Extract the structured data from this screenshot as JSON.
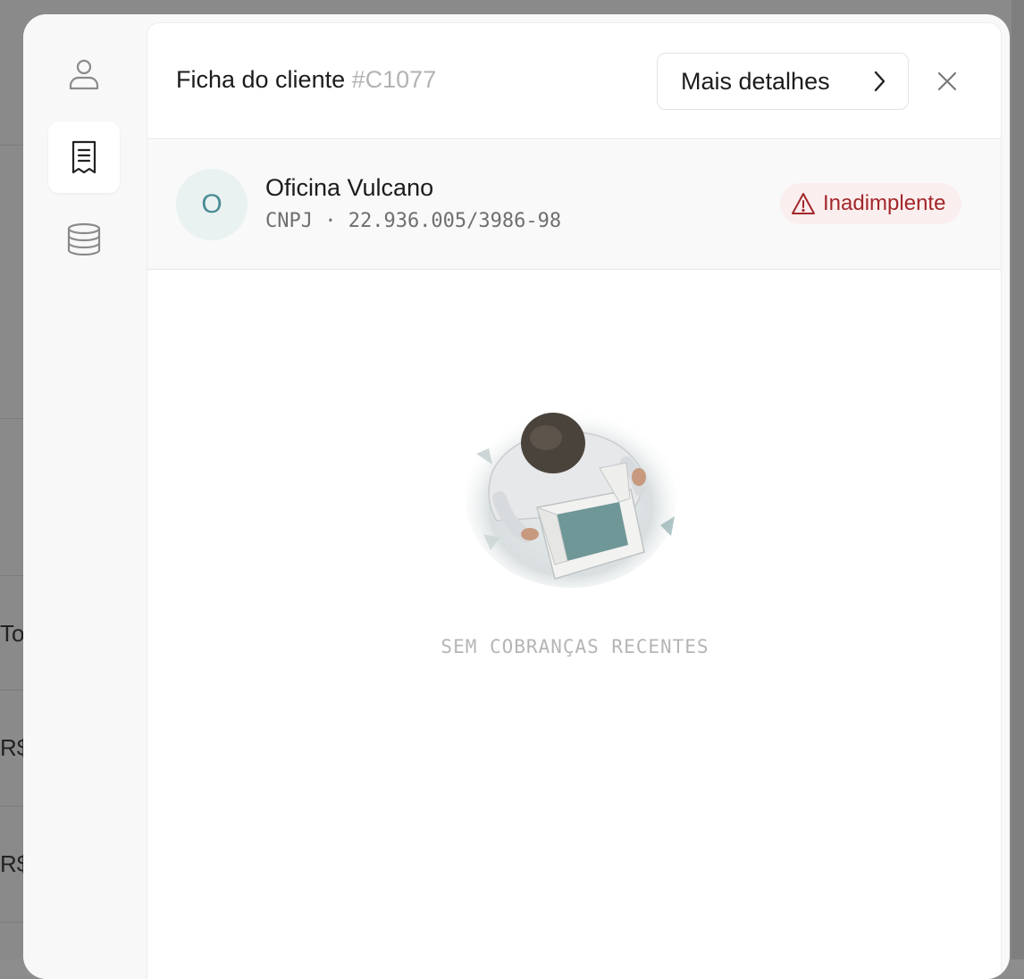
{
  "background": {
    "rows": [
      "To",
      "R$",
      "R$"
    ]
  },
  "rail": {
    "items": [
      {
        "icon": "user-icon",
        "active": false
      },
      {
        "icon": "receipt-icon",
        "active": true
      },
      {
        "icon": "database-icon",
        "active": false
      }
    ]
  },
  "header": {
    "title": "Ficha do cliente",
    "code": "#C1077",
    "details_label": "Mais detalhes"
  },
  "client": {
    "initial": "O",
    "name": "Oficina Vulcano",
    "doc": "CNPJ · 22.936.005/3986-98",
    "status": "Inadimplente"
  },
  "empty_state": {
    "message": "SEM COBRANÇAS RECENTES"
  },
  "colors": {
    "accent": "#4a8c94",
    "danger": "#a3272a",
    "danger_bg": "#fbeeee"
  }
}
